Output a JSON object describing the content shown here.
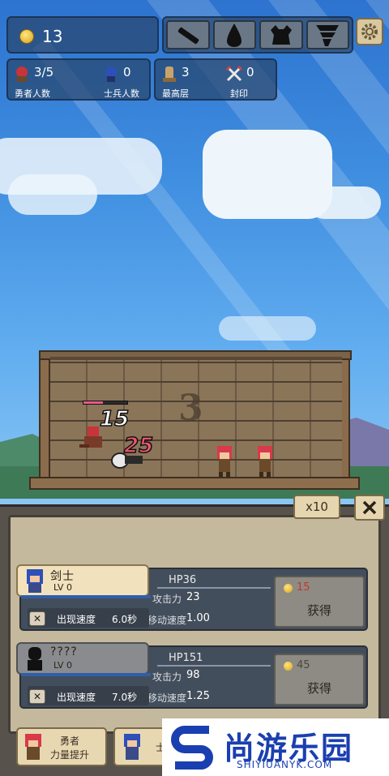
{
  "hud": {
    "gold": "13",
    "heroes": {
      "value": "3/5",
      "label": "勇者人数"
    },
    "soldiers": {
      "value": "0",
      "label": "士兵人数"
    },
    "top_floor": {
      "value": "3",
      "label": "最高层"
    },
    "seal": {
      "value": "0",
      "label": "封印"
    },
    "tools": [
      "stick-icon",
      "water-drop-icon",
      "monster-silhouette-icon",
      "tornado-icon"
    ],
    "settings_icon": "gear-icon"
  },
  "battle": {
    "wall_number": "3",
    "damage_white": "15",
    "damage_pink": "25",
    "enemy_hp_level": 0.45
  },
  "panel": {
    "multiplier": "x10",
    "units": [
      {
        "name": "剑士",
        "level": "LV 0",
        "hp": "HP36",
        "attack_label": "攻击力",
        "attack": "23",
        "move_label": "移动速度",
        "move": "1.00",
        "spawn_label": "出现速度",
        "spawn": "6.0秒",
        "price": "15",
        "buy_label": "获得",
        "locked": false
      },
      {
        "name": "????",
        "level": "LV 0",
        "hp": "HP151",
        "attack_label": "攻击力",
        "attack": "98",
        "move_label": "移动速度",
        "move": "1.25",
        "spawn_label": "出现速度",
        "spawn": "7.0秒",
        "price": "45",
        "buy_label": "获得",
        "locked": true
      }
    ]
  },
  "tabs": [
    {
      "line1": "勇者",
      "line2": "力量提升"
    },
    {
      "line1": "士",
      "line2": ""
    }
  ],
  "watermark": {
    "title": "尚游乐园",
    "sub": "SHIYIUANYK.COM"
  },
  "colors": {
    "hp_bar": "#e65a8a",
    "damage_pink": "#f0566f",
    "xp_bar": "#2f5fa8",
    "watermark": "#1a3fb0"
  }
}
